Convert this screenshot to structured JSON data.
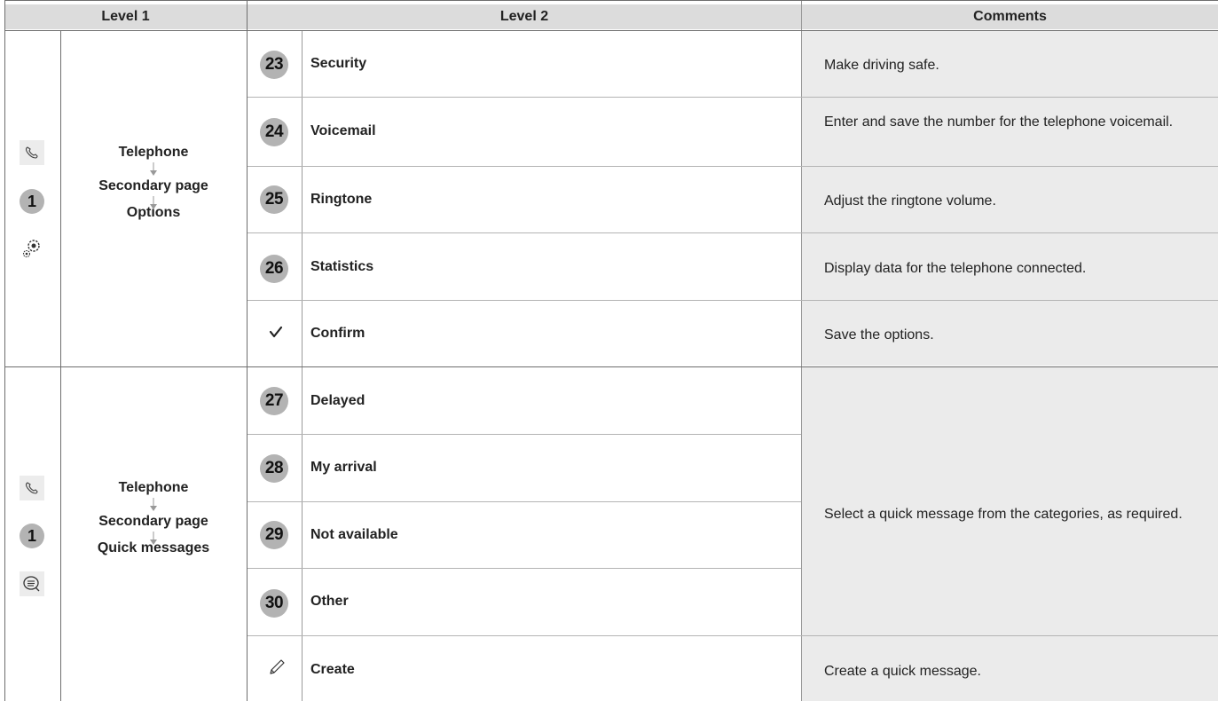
{
  "headers": {
    "level1": "Level 1",
    "level2": "Level 2",
    "comments": "Comments"
  },
  "section1": {
    "path": [
      "Telephone",
      "Secondary page",
      "Options"
    ],
    "badge": "1",
    "rows": [
      {
        "num": "23",
        "label": "Security",
        "comment": "Make driving safe."
      },
      {
        "num": "24",
        "label": "Voicemail",
        "comment": "Enter and save the number for the telephone voicemail."
      },
      {
        "num": "25",
        "label": "Ringtone",
        "comment": "Adjust the ringtone volume."
      },
      {
        "num": "26",
        "label": "Statistics",
        "comment": "Display data for the telephone connected."
      },
      {
        "num": "",
        "icon": "checkmark-icon",
        "label": "Confirm",
        "comment": "Save the options."
      }
    ]
  },
  "section2": {
    "path": [
      "Telephone",
      "Secondary page",
      "Quick messages"
    ],
    "badge": "1",
    "shared_comment": "Select a quick message from the categories, as required.",
    "rows": [
      {
        "num": "27",
        "label": "Delayed"
      },
      {
        "num": "28",
        "label": "My arrival"
      },
      {
        "num": "29",
        "label": "Not available"
      },
      {
        "num": "30",
        "label": "Other"
      },
      {
        "num": "",
        "icon": "pencil-icon",
        "label": "Create",
        "comment": "Create a quick message."
      }
    ]
  }
}
